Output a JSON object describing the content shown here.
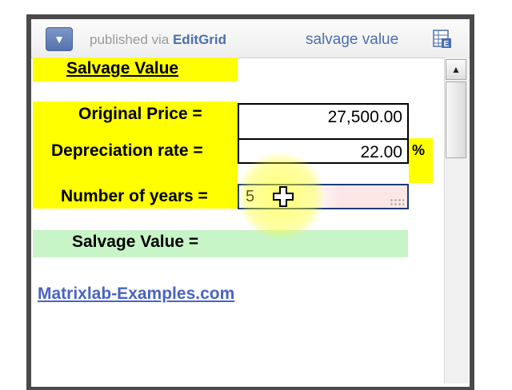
{
  "header": {
    "published_prefix": "published via ",
    "brand": "EditGrid",
    "sheet_name": "salvage value",
    "menu_icon": "chevron-down-icon",
    "sheet_icon": "spreadsheet-icon"
  },
  "sheet": {
    "title": "Salvage Value",
    "original_price_label": "Original Price =",
    "original_price_value": "27,500.00",
    "depreciation_label": "Depreciation rate =",
    "depreciation_value": "22.00",
    "percent_sign": "%",
    "years_label": "Number of years =",
    "years_value": "5",
    "salvage_label": "Salvage Value ="
  },
  "link": {
    "text": "Matrixlab-Examples.com"
  },
  "scrollbar": {
    "up_icon": "arrow-up-icon"
  },
  "colors": {
    "accent_yellow": "#ffff00",
    "result_green": "#c8f5c8",
    "brand_blue": "#4b6fae",
    "link_blue": "#4a64c0"
  }
}
